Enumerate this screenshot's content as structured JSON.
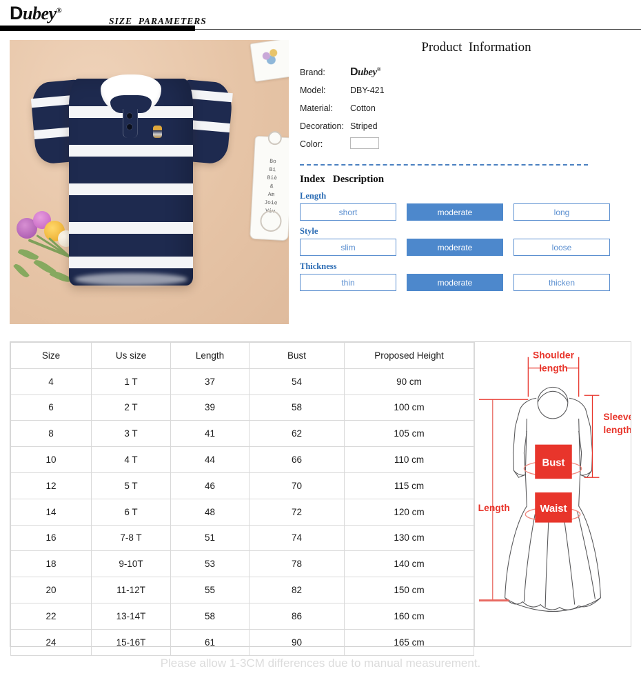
{
  "header": {
    "logo_text": "ubey",
    "logo_initial": "D",
    "logo_reg": "®",
    "title": "SIZE  PARAMETERS"
  },
  "product_info": {
    "title": "Product  Information",
    "specs": [
      {
        "key": "Brand:",
        "value": "ubey",
        "type": "logo"
      },
      {
        "key": "Model:",
        "value": "DBY-421",
        "type": "text"
      },
      {
        "key": "Material:",
        "value": "Cotton",
        "type": "text"
      },
      {
        "key": "Decoration:",
        "value": "Striped",
        "type": "text"
      },
      {
        "key": "Color:",
        "value": "",
        "type": "swatch",
        "swatch_hex": "#ffffff"
      }
    ]
  },
  "index_section": {
    "heading": "Index   Description",
    "groups": [
      {
        "label": "Length",
        "options": [
          "short",
          "moderate",
          "long"
        ],
        "selected": 1
      },
      {
        "label": "Style",
        "options": [
          "slim",
          "moderate",
          "loose"
        ],
        "selected": 1
      },
      {
        "label": "Thickness",
        "options": [
          "thin",
          "moderate",
          "thicken"
        ],
        "selected": 1
      }
    ]
  },
  "size_table": {
    "columns": [
      "Size",
      "Us size",
      "Length",
      "Bust",
      "Proposed Height"
    ],
    "rows": [
      [
        "4",
        "1 T",
        "37",
        "54",
        "90 cm"
      ],
      [
        "6",
        "2 T",
        "39",
        "58",
        "100 cm"
      ],
      [
        "8",
        "3 T",
        "41",
        "62",
        "105 cm"
      ],
      [
        "10",
        "4 T",
        "44",
        "66",
        "110 cm"
      ],
      [
        "12",
        "5 T",
        "46",
        "70",
        "115 cm"
      ],
      [
        "14",
        "6 T",
        "48",
        "72",
        "120 cm"
      ],
      [
        "16",
        "7-8 T",
        "51",
        "74",
        "130 cm"
      ],
      [
        "18",
        "9-10T",
        "53",
        "78",
        "140 cm"
      ],
      [
        "20",
        "11-12T",
        "55",
        "82",
        "150 cm"
      ],
      [
        "22",
        "13-14T",
        "58",
        "86",
        "160 cm"
      ],
      [
        "24",
        "15-16T",
        "61",
        "90",
        "165 cm"
      ]
    ]
  },
  "diagram": {
    "labels": {
      "shoulder_line1": "Shoulder",
      "shoulder_line2": "length",
      "sleeve_line1": "Sleeve",
      "sleeve_line2": "length",
      "bust": "Bust",
      "waist": "Waist",
      "length": "Length"
    },
    "accent_hex": "#e8352b"
  },
  "footer": {
    "note": "Please allow 1-3CM differences due to manual measurement."
  },
  "colors": {
    "accent_blue": "#4d88cc",
    "label_blue": "#2b6cb4",
    "outline_blue": "#5b8fd0",
    "shirt_navy": "#1e2a4f",
    "diagram_red": "#e8352b"
  }
}
